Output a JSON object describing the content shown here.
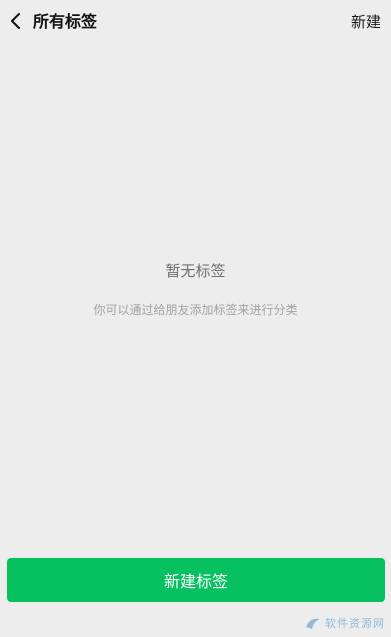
{
  "nav": {
    "title": "所有标签",
    "action_label": "新建",
    "back_icon": "chevron-left-icon"
  },
  "empty_state": {
    "title": "暂无标签",
    "description": "你可以通过给朋友添加标签来进行分类"
  },
  "primary_button": {
    "label": "新建标签",
    "color": "#07c160"
  },
  "watermark": {
    "text": "软件资源网"
  }
}
